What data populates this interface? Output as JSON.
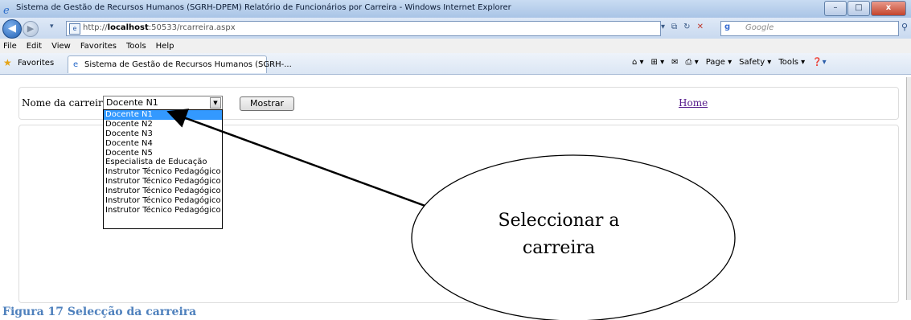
{
  "window": {
    "title": "Sistema de Gestão de Recursos Humanos (SGRH-DPEM) Relatório de Funcionários por Carreira - Windows Internet Explorer",
    "minimize": "–",
    "restore": "□",
    "close": "x"
  },
  "address_bar": {
    "url_prefix": "http://",
    "url_host": "localhost",
    "url_rest": ":50533/rcarreira.aspx",
    "search_provider": "Google",
    "search_placeholder": "Google"
  },
  "menu": [
    "File",
    "Edit",
    "View",
    "Favorites",
    "Tools",
    "Help"
  ],
  "favorites_bar": {
    "favorites_label": "Favorites",
    "tab_label": "Sistema de Gestão de Recursos Humanos (SGRH-...",
    "commands": [
      "Page ▾",
      "Safety ▾",
      "Tools ▾"
    ]
  },
  "form": {
    "label": "Nome da carreira",
    "selected": "Docente N1",
    "button": "Mostrar",
    "home_link": "Home"
  },
  "dropdown_options": [
    "Docente N1",
    "Docente N2",
    "Docente N3",
    "Docente N4",
    "Docente N5",
    "Especialista de Educação",
    "Instrutor Técnico Pedagógico",
    "Instrutor Técnico Pedagógico",
    "Instrutor Técnico Pedagógico",
    "Instrutor Técnico Pedagógico",
    "Instrutor Técnico Pedagógico"
  ],
  "callout": {
    "line1": "Seleccionar a",
    "line2": "carreira"
  },
  "caption": "Figura 17 Selecção da carreira"
}
